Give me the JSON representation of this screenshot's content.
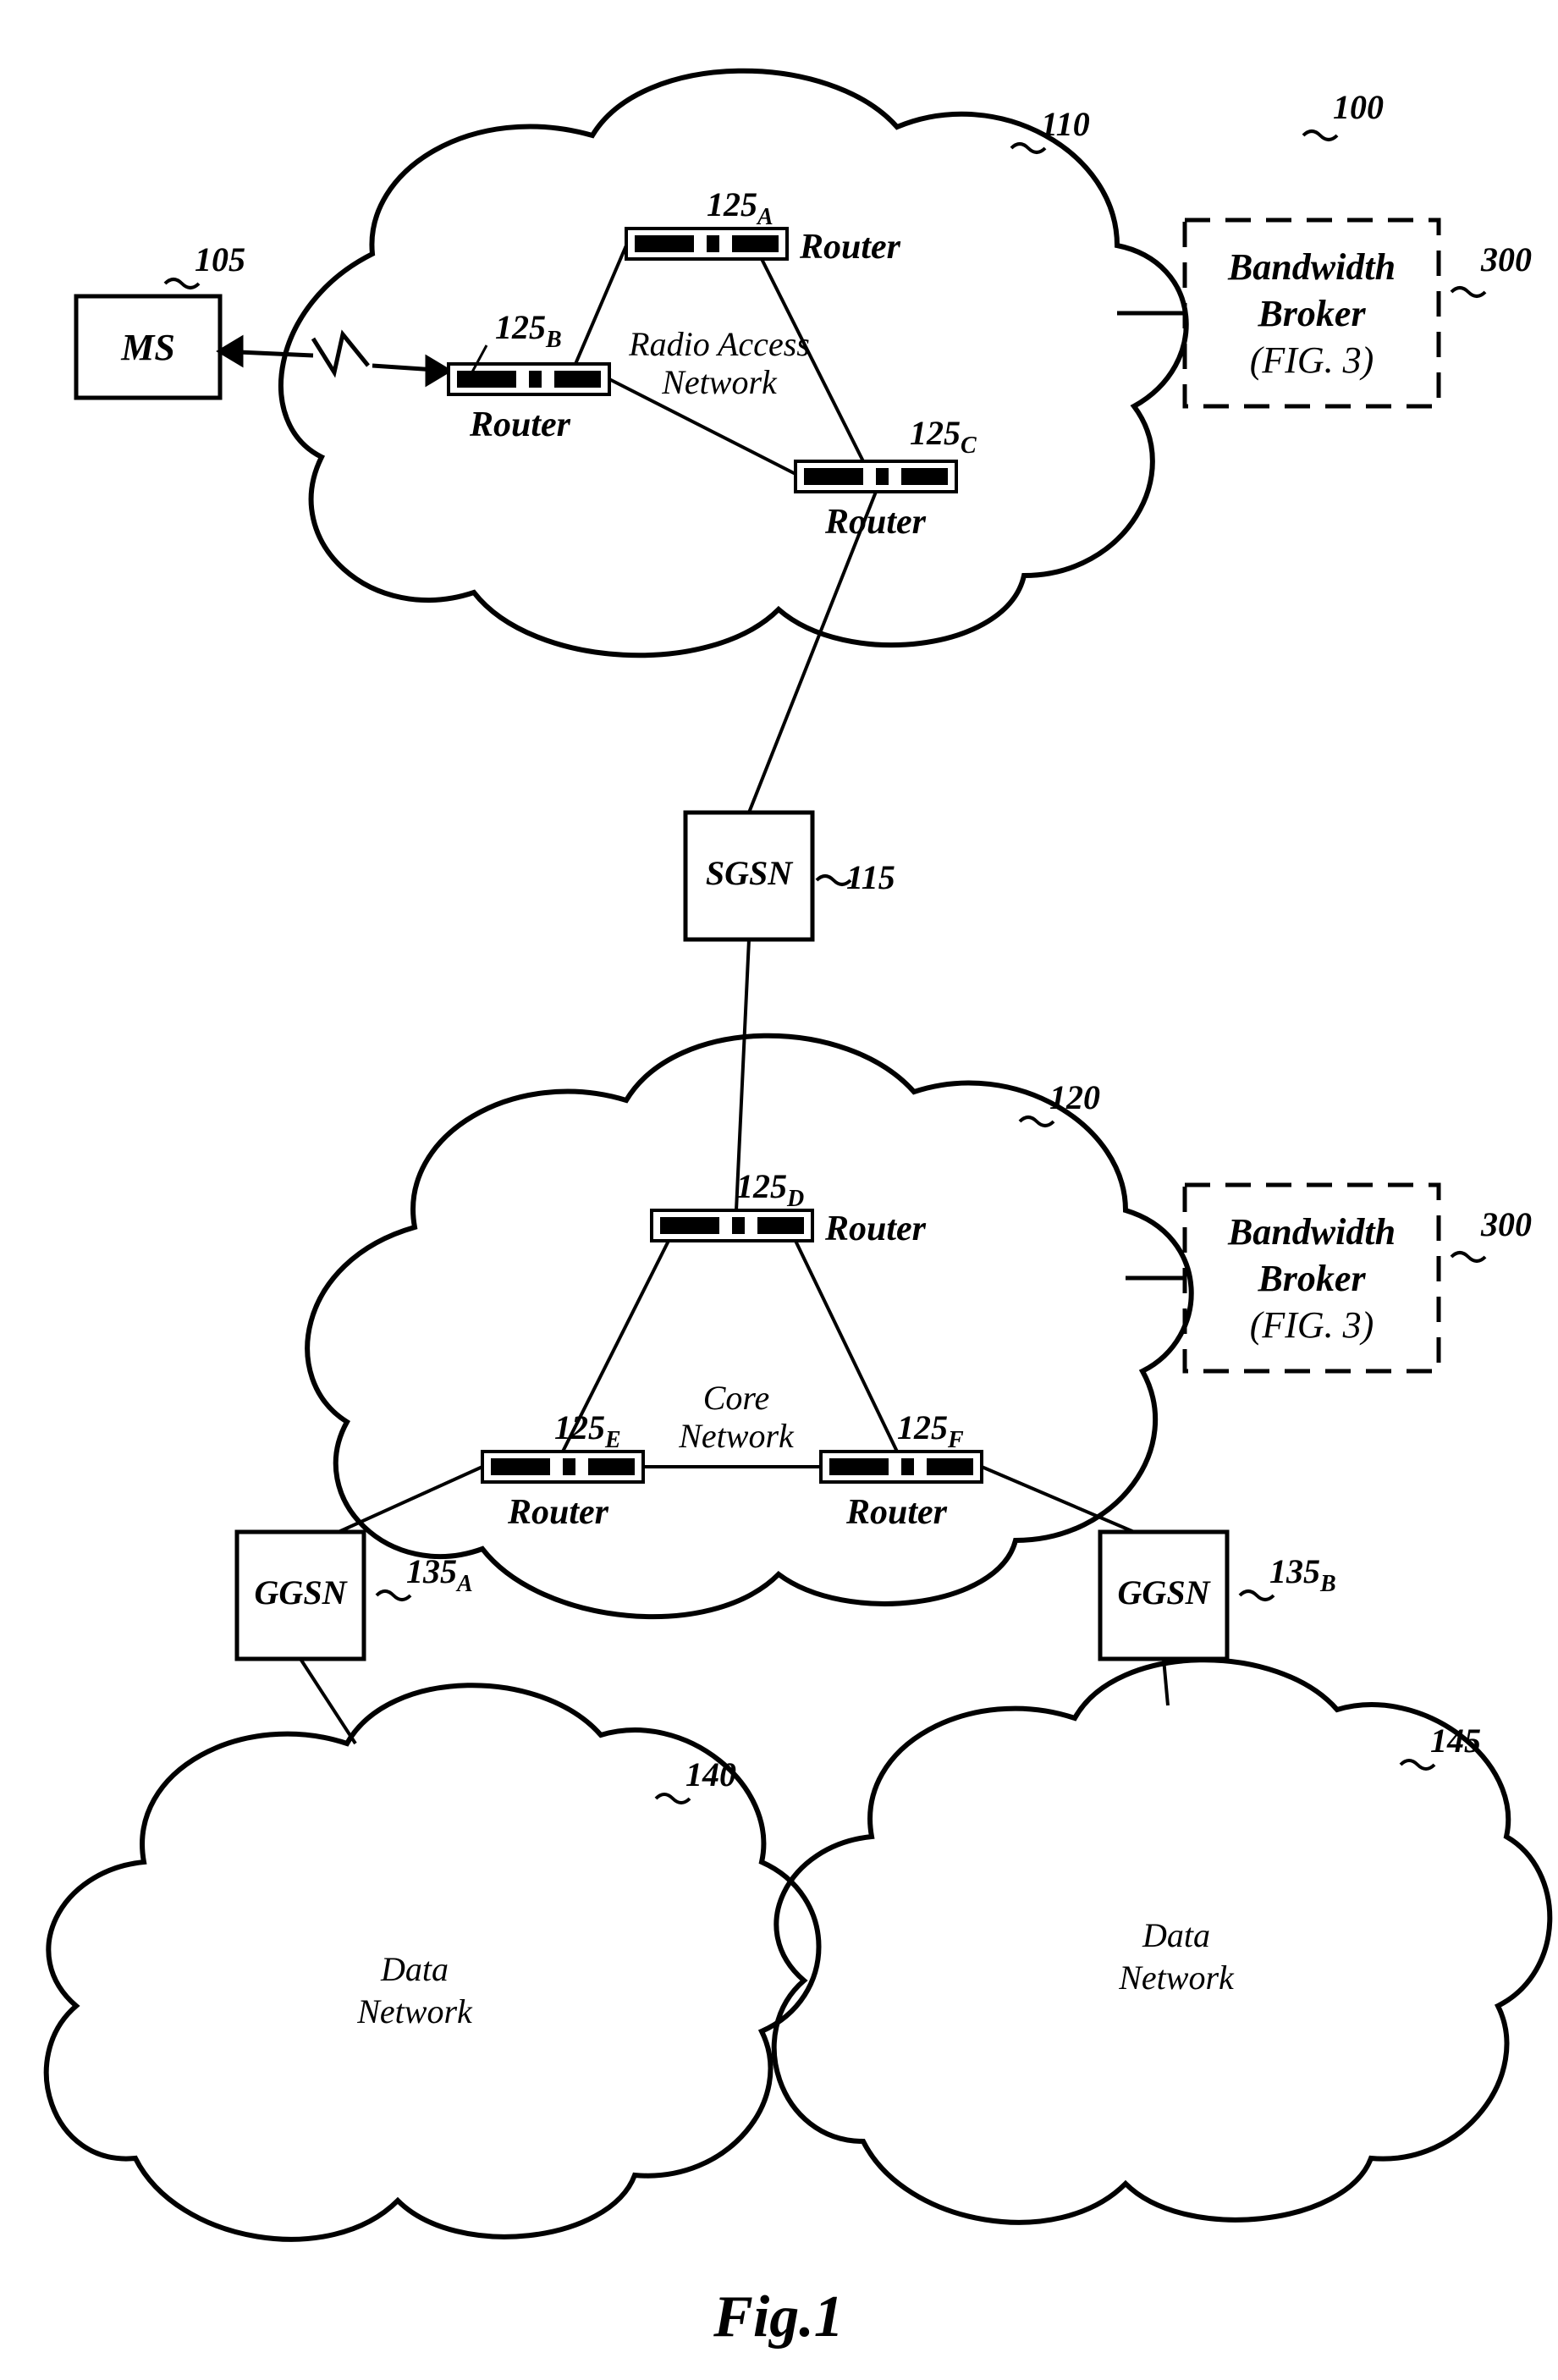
{
  "figure_label": "Fig.1",
  "ref100": "100",
  "ref300a": "300",
  "ref300b": "300",
  "ref110": "110",
  "ref105": "105",
  "ref115": "115",
  "ref120": "120",
  "ref135a": "135",
  "ref135a_sub": "A",
  "ref135b": "135",
  "ref135b_sub": "B",
  "ref140": "140",
  "ref145": "145",
  "ref125a": "125",
  "ref125a_sub": "A",
  "ref125b": "125",
  "ref125b_sub": "B",
  "ref125c": "125",
  "ref125c_sub": "C",
  "ref125d": "125",
  "ref125d_sub": "D",
  "ref125e": "125",
  "ref125e_sub": "E",
  "ref125f": "125",
  "ref125f_sub": "F",
  "label_ms": "MS",
  "label_sgsn": "SGSN",
  "label_ggsn_a": "GGSN",
  "label_ggsn_b": "GGSN",
  "label_router_a": "Router",
  "label_router_b": "Router",
  "label_router_c": "Router",
  "label_router_d": "Router",
  "label_router_e": "Router",
  "label_router_f": "Router",
  "label_ran1": "Radio Access",
  "label_ran2": "Network",
  "label_core1": "Core",
  "label_core2": "Network",
  "label_data1a": "Data",
  "label_data1b": "Network",
  "label_data2a": "Data",
  "label_data2b": "Network",
  "label_bb1a": "Bandwidth",
  "label_bb1b": "Broker",
  "label_bb1c": "(FIG. 3)",
  "label_bb2a": "Bandwidth",
  "label_bb2b": "Broker",
  "label_bb2c": "(FIG. 3)"
}
